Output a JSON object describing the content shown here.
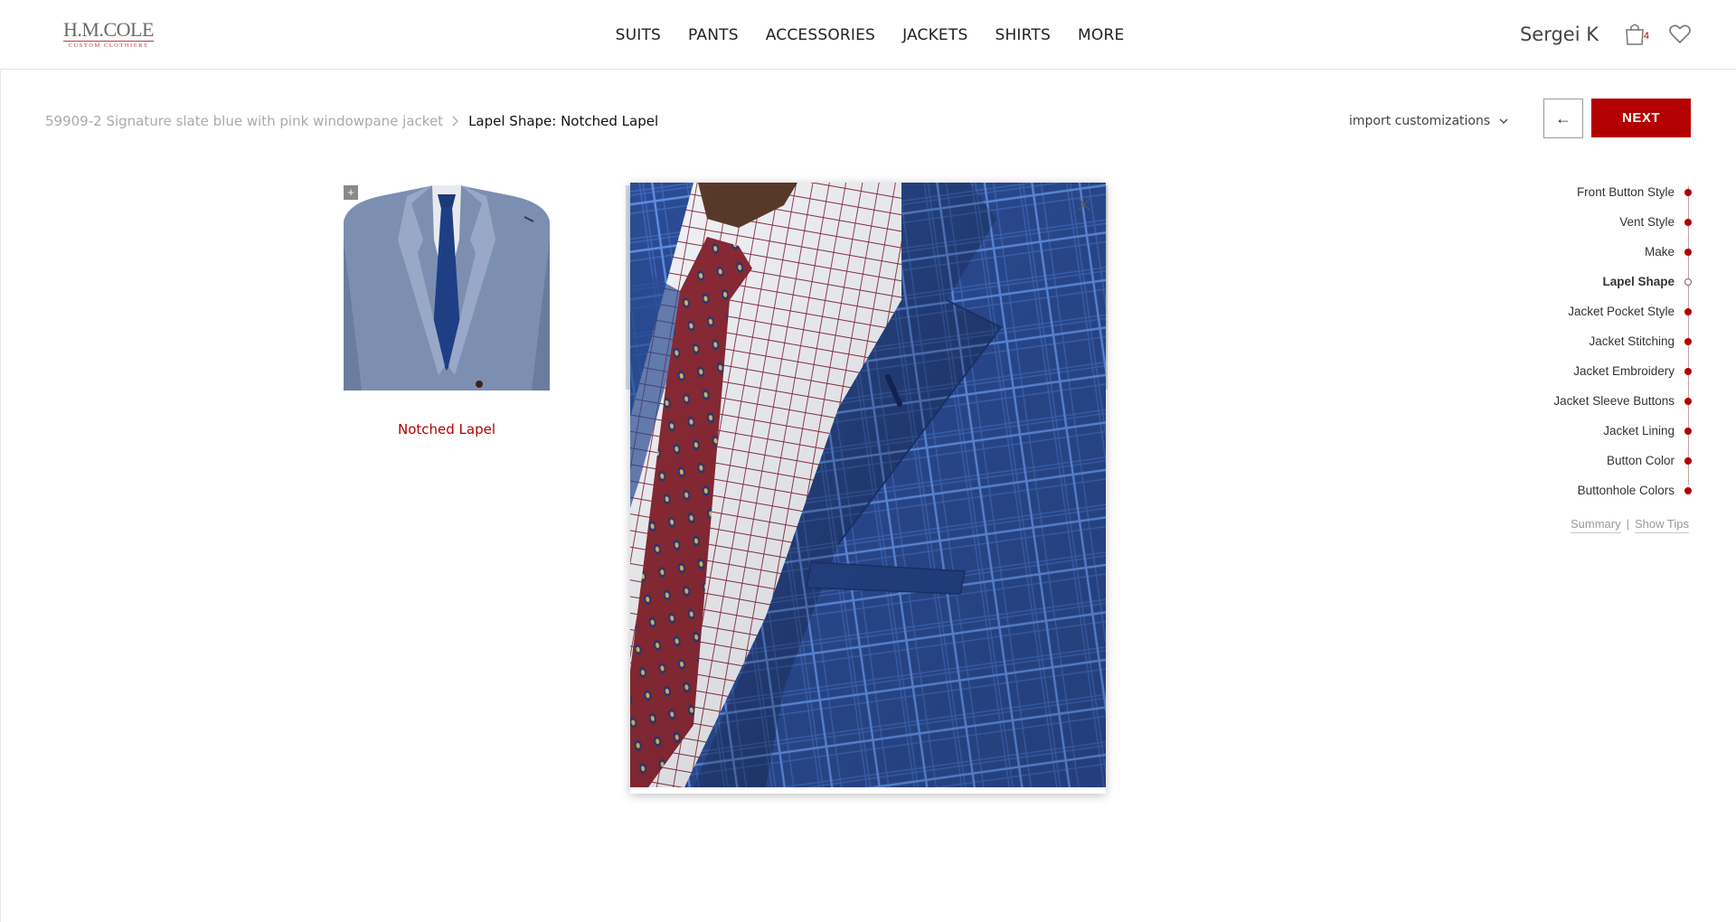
{
  "header": {
    "logo_main": "H.M.COLE",
    "logo_sub": "CUSTOM CLOTHIERS",
    "nav": [
      "SUITS",
      "PANTS",
      "ACCESSORIES",
      "JACKETS",
      "SHIRTS",
      "MORE"
    ],
    "user_name": "Sergei K",
    "cart_count": "4"
  },
  "breadcrumb": {
    "parent": "59909-2 Signature slate blue with pink windowpane jacket",
    "separator": ">",
    "current": "Lapel Shape: Notched Lapel"
  },
  "toolbar": {
    "import_label": "import customizations",
    "back_label": "←",
    "next_label": "NEXT"
  },
  "option": {
    "zoom_label": "+",
    "label": "Notched Lapel"
  },
  "steps": [
    {
      "label": "Front Button Style",
      "current": false
    },
    {
      "label": "Vent Style",
      "current": false
    },
    {
      "label": "Make",
      "current": false
    },
    {
      "label": "Lapel Shape",
      "current": true
    },
    {
      "label": "Jacket Pocket Style",
      "current": false
    },
    {
      "label": "Jacket Stitching",
      "current": false
    },
    {
      "label": "Jacket Embroidery",
      "current": false
    },
    {
      "label": "Jacket Sleeve Buttons",
      "current": false
    },
    {
      "label": "Jacket Lining",
      "current": false
    },
    {
      "label": "Button Color",
      "current": false
    },
    {
      "label": "Buttonhole Colors",
      "current": false
    }
  ],
  "links": {
    "summary": "Summary",
    "divider": "|",
    "tips": "Show Tips"
  },
  "colors": {
    "accent": "#b30000",
    "jacket_blue": "#2d4f9a",
    "option_jacket": "#7d8fb0"
  }
}
